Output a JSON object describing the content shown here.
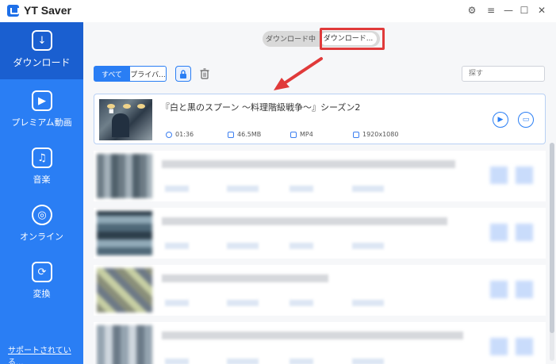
{
  "app": {
    "title": "YT Saver"
  },
  "window_controls": {
    "settings": "⚙",
    "menu": "≡",
    "minimize": "—",
    "maximize": "☐",
    "close": "✕"
  },
  "sidebar": {
    "items": [
      {
        "label": "ダウンロード",
        "icon": "download-icon",
        "glyph": "↓",
        "active": true
      },
      {
        "label": "プレミアム動画",
        "icon": "play-icon",
        "glyph": "▶",
        "active": false
      },
      {
        "label": "音楽",
        "icon": "music-note-icon",
        "glyph": "♫",
        "active": false
      },
      {
        "label": "オンライン",
        "icon": "globe-icon",
        "glyph": "◎",
        "active": false
      },
      {
        "label": "変換",
        "icon": "convert-icon",
        "glyph": "⟳",
        "active": false
      }
    ],
    "support_link": "サポートされている..."
  },
  "toggle": {
    "downloading": "ダウンロード中",
    "downloaded": "ダウンロード..."
  },
  "filters": {
    "all": "すべて",
    "private": "プライバ..."
  },
  "search": {
    "placeholder": "探す"
  },
  "colors": {
    "accent": "#2a7ef4",
    "highlight": "#e03a3a"
  },
  "video": {
    "title": "『白と黒のスプーン ～料理階級戦争～』シーズン2",
    "duration": "01:36",
    "size": "46.5MB",
    "format": "MP4",
    "resolution": "1920x1080",
    "play_glyph": "▶",
    "folder_glyph": "▭"
  }
}
